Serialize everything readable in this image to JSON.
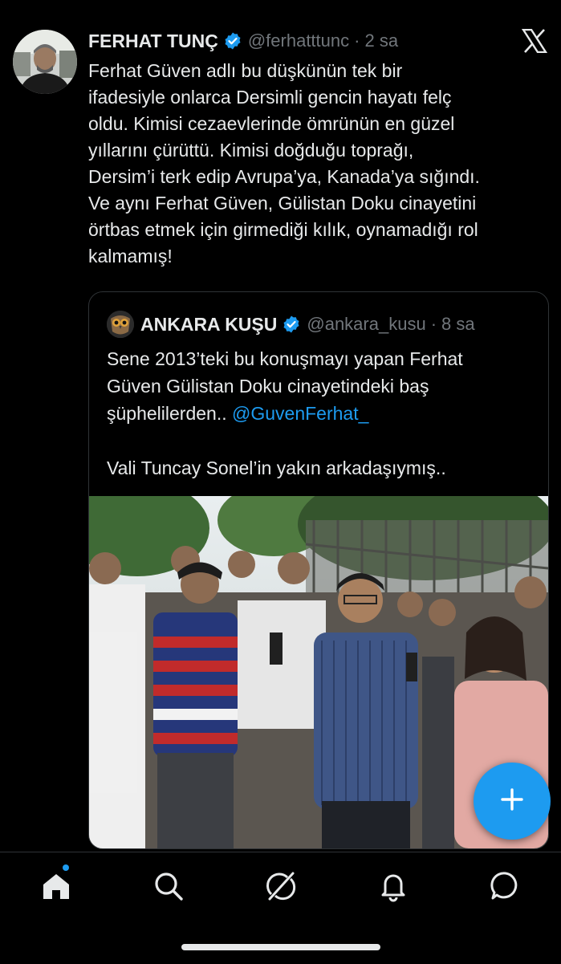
{
  "tweet": {
    "author_name": "FERHAT TUNÇ",
    "handle": "@ferhatttunc",
    "separator": "·",
    "time": "2 sa",
    "text": "Ferhat Güven adlı bu düşkünün tek bir\nifadesiyle onlarca Dersimli gencin hayatı felç\noldu. Kimisi cezaevlerinde ömrünün en güzel\nyıllarını çürüttü. Kimisi doğduğu toprağı,\nDersim’i terk edip Avrupa’ya, Kanada’ya sığındı.\nVe aynı Ferhat Güven, Gülistan Doku cinayetini\nörtbas etmek için girmediği kılık, oynamadığı rol\nkalmamış!"
  },
  "quote": {
    "author_name": "ANKARA KUŞU",
    "handle": "@ankara_kusu",
    "separator": "·",
    "time": "8 sa",
    "text_main": "Sene 2013’teki bu konuşmayı yapan Ferhat\nGüven Gülistan Doku cinayetindeki baş\nşüphelilerden.. ",
    "mention": "@GuvenFerhat_",
    "text_after": "\n\nVali Tuncay Sonel’in yakın arkadaşıymış.."
  },
  "icons": {
    "verified": "verified-badge-icon",
    "x_logo": "x-logo-icon",
    "compose": "plus-icon",
    "home": "home-icon",
    "search": "search-icon",
    "grok": "grok-icon",
    "notifications": "bell-icon",
    "messages": "message-icon"
  },
  "colors": {
    "accent": "#1d9bf0",
    "background": "#000000",
    "text": "#e7e9ea",
    "secondary_text": "#71767b"
  }
}
